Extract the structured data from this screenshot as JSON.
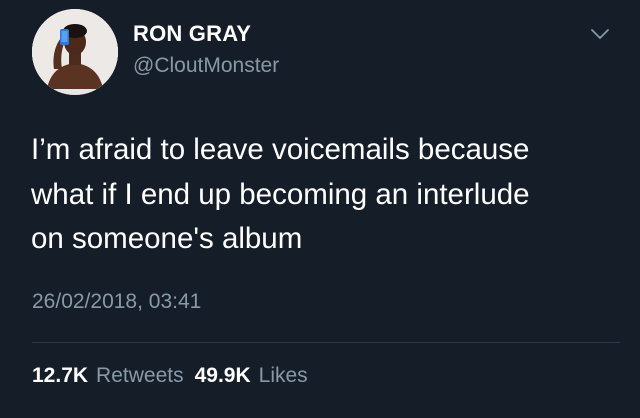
{
  "tweet": {
    "author": {
      "name": "RON GRAY",
      "handle": "@CloutMonster",
      "avatar_icon": "profile-photo"
    },
    "text_lines": [
      "I’m afraid to leave voicemails because",
      "what if I end up becoming an interlude",
      "on someone's album"
    ],
    "timestamp": "26/02/2018, 03:41",
    "stats": {
      "retweets_count": "12.7K",
      "retweets_label": "Retweets",
      "likes_count": "49.9K",
      "likes_label": "Likes"
    },
    "menu_icon": "chevron-down-icon"
  },
  "colors": {
    "background": "#151e28",
    "primary_text": "#ffffff",
    "secondary_text": "#8899a6",
    "divider": "#2b3a48"
  }
}
